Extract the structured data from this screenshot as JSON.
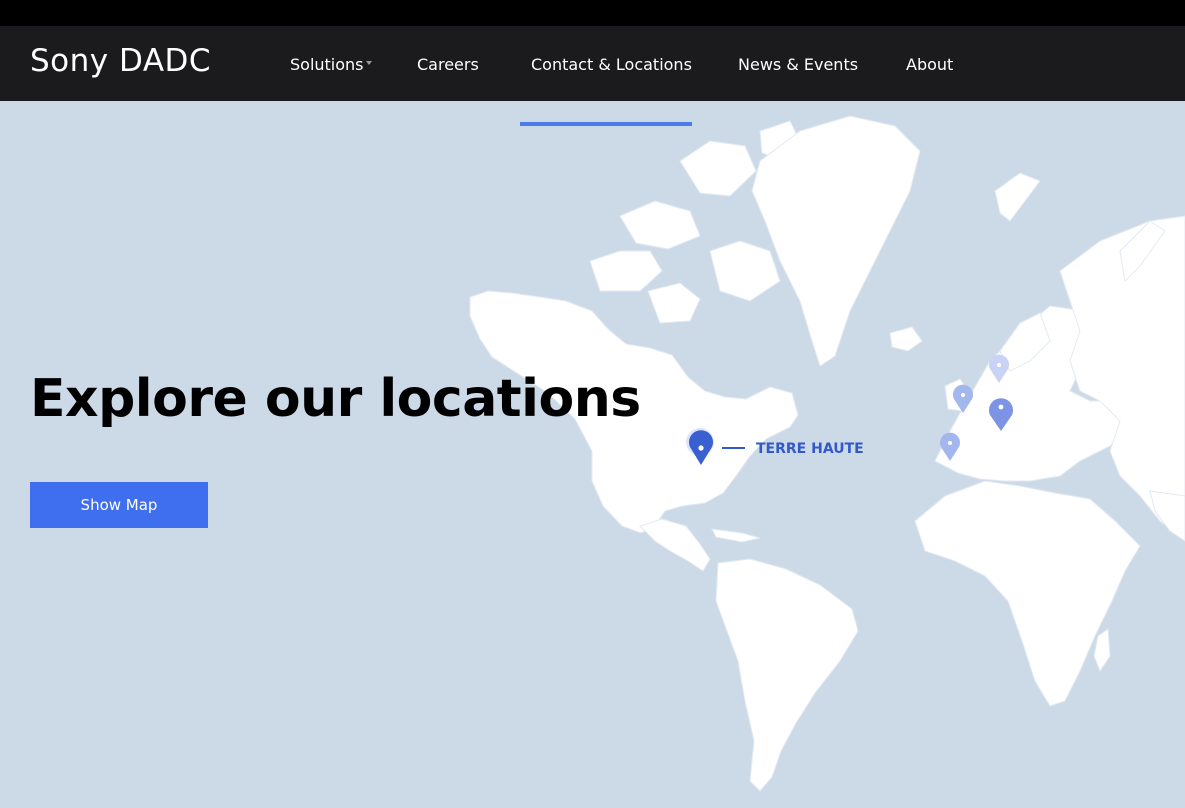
{
  "brand": {
    "name": "Sony DADC"
  },
  "nav": {
    "items": [
      {
        "label": "Solutions"
      },
      {
        "label": "Careers"
      },
      {
        "label": "Contact & Locations"
      },
      {
        "label": "News & Events"
      },
      {
        "label": "About"
      }
    ],
    "active": "Contact & Locations"
  },
  "hero": {
    "title": "Explore our locations",
    "button_label": "Show Map"
  },
  "map": {
    "selected_location": "TERRE HAUTE",
    "pin_icons": [
      "location-pin-icon",
      "location-pin-icon",
      "location-pin-icon",
      "location-pin-icon",
      "location-pin-icon"
    ]
  },
  "colors": {
    "nav_bg": "#1b1b1d",
    "accent": "#3f6fee",
    "map_water": "#ccdae8",
    "map_land": "#ffffff",
    "pin_active": "#3258c9",
    "pin_inactive": "#9fb2ee"
  }
}
